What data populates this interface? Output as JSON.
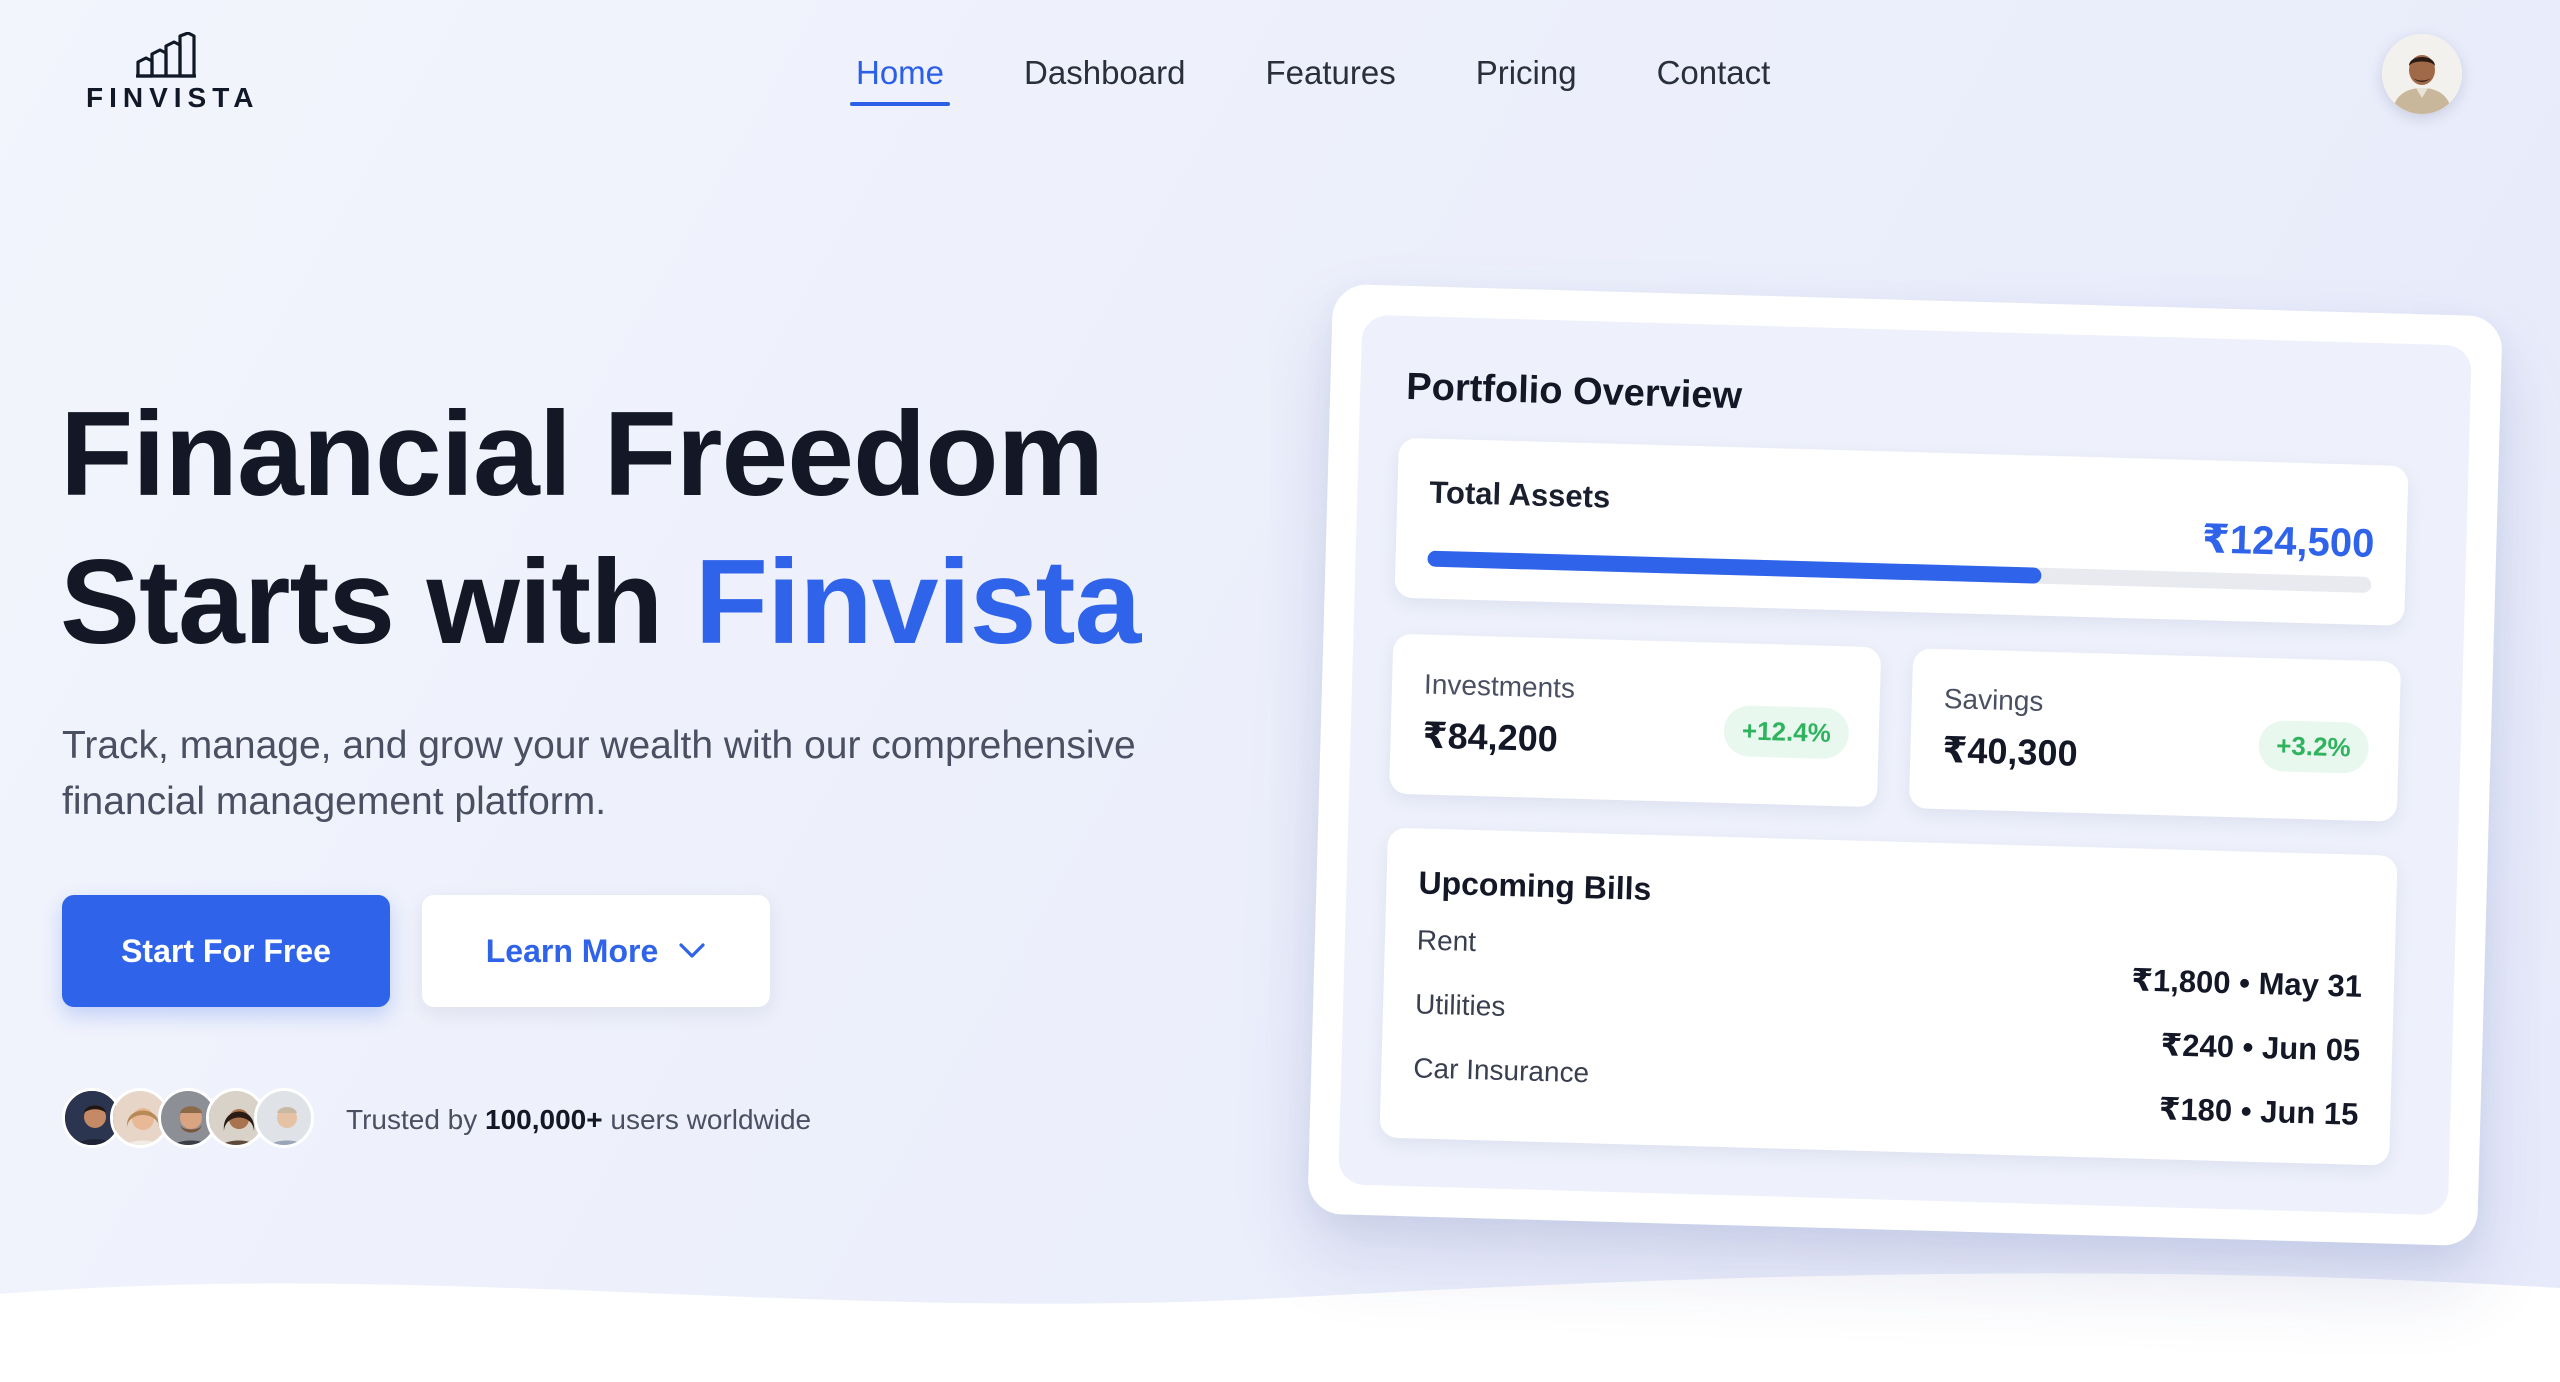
{
  "brand": {
    "name": "FINVISTA",
    "accent": "#2f63ea"
  },
  "nav": {
    "items": [
      "Home",
      "Dashboard",
      "Features",
      "Pricing",
      "Contact"
    ],
    "active": "Home"
  },
  "hero": {
    "title_line1": "Financial Freedom",
    "title_line2_prefix": "Starts with ",
    "title_line2_accent": "Finvista",
    "subtitle": "Track, manage, and grow your wealth with our comprehensive financial management platform.",
    "primary_button": "Start For Free",
    "secondary_button": "Learn More",
    "trust_prefix": "Trusted by ",
    "trust_count": "100,000+",
    "trust_suffix": " users worldwide"
  },
  "portfolio": {
    "title": "Portfolio Overview",
    "total_assets_label": "Total Assets",
    "total_assets_value": "₹124,500",
    "total_assets_progress": 0.65,
    "investments": {
      "label": "Investments",
      "value": "₹84,200",
      "change": "+12.4%"
    },
    "savings": {
      "label": "Savings",
      "value": "₹40,300",
      "change": "+3.2%"
    },
    "bills_title": "Upcoming Bills",
    "bills": [
      {
        "name": "Rent",
        "amount": "₹1,800 • May 31"
      },
      {
        "name": "Utilities",
        "amount": "₹240 • Jun 05"
      },
      {
        "name": "Car Insurance",
        "amount": "₹180 • Jun 15"
      }
    ]
  },
  "icons": {
    "logo": "bar-chart-buildings-icon",
    "learn_more": "chevron-down-icon",
    "profile": "user-avatar"
  }
}
